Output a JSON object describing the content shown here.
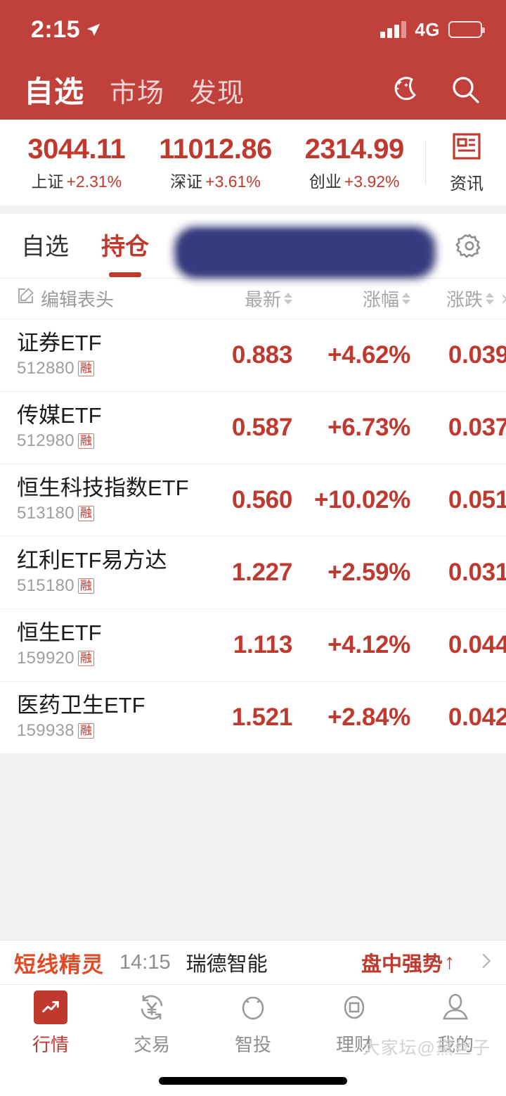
{
  "status_bar": {
    "time": "2:15",
    "location_icon": "location-arrow-icon",
    "signal_icon": "signal-bars-icon",
    "network": "4G",
    "battery_icon": "battery-low-icon",
    "battery_level_pct": 12
  },
  "header": {
    "tabs": [
      {
        "label": "自选",
        "active": true
      },
      {
        "label": "市场",
        "active": false
      },
      {
        "label": "发现",
        "active": false
      }
    ],
    "night_mode_icon": "moon-stars-icon",
    "search_icon": "search-icon",
    "background_color": "#c0413b"
  },
  "index_bar": {
    "indices": [
      {
        "value": "3044.11",
        "name": "上证",
        "change_pct": "+2.31%"
      },
      {
        "value": "11012.86",
        "name": "深证",
        "change_pct": "+3.61%"
      },
      {
        "value": "2314.99",
        "name": "创业",
        "change_pct": "+3.92%"
      }
    ],
    "news": {
      "label": "资讯",
      "icon": "news-document-icon"
    },
    "up_color": "#c0392f"
  },
  "sub_tabs": {
    "items": [
      {
        "label": "自选",
        "active": false
      },
      {
        "label": "持仓",
        "active": true
      },
      {
        "label": "",
        "active": false,
        "redacted": true
      }
    ],
    "settings_icon": "gear-icon",
    "redaction_color": "#2f3475"
  },
  "table": {
    "edit_header": {
      "label": "编辑表头",
      "icon": "edit-pencil-icon"
    },
    "columns": [
      {
        "label": "最新",
        "sortable": true
      },
      {
        "label": "涨幅",
        "sortable": true
      },
      {
        "label": "涨跌",
        "sortable": true
      }
    ],
    "more_icon": "chevron-right-icon",
    "rows": [
      {
        "name": "证券ETF",
        "code": "512880",
        "badge": "融",
        "last": "0.883",
        "change_pct": "+4.62%",
        "change": "0.039"
      },
      {
        "name": "传媒ETF",
        "code": "512980",
        "badge": "融",
        "last": "0.587",
        "change_pct": "+6.73%",
        "change": "0.037"
      },
      {
        "name": "恒生科技指数ETF",
        "code": "513180",
        "badge": "融",
        "last": "0.560",
        "change_pct": "+10.02%",
        "change": "0.051"
      },
      {
        "name": "红利ETF易方达",
        "code": "515180",
        "badge": "融",
        "last": "1.227",
        "change_pct": "+2.59%",
        "change": "0.031"
      },
      {
        "name": "恒生ETF",
        "code": "159920",
        "badge": "融",
        "last": "1.113",
        "change_pct": "+4.12%",
        "change": "0.044"
      },
      {
        "name": "医药卫生ETF",
        "code": "159938",
        "badge": "融",
        "last": "1.521",
        "change_pct": "+2.84%",
        "change": "0.042"
      }
    ]
  },
  "ticker": {
    "brand": "短线精灵",
    "time": "14:15",
    "stock_name": "瑞德智能",
    "tag": "盘中强势",
    "tag_arrow": "↑",
    "chevron_icon": "chevron-right-icon"
  },
  "bottom_nav": {
    "items": [
      {
        "label": "行情",
        "icon": "trend-chart-icon",
        "active": true
      },
      {
        "label": "交易",
        "icon": "yuan-exchange-icon",
        "active": false
      },
      {
        "label": "智投",
        "icon": "circle-brain-icon",
        "active": false
      },
      {
        "label": "理财",
        "icon": "wallet-circle-icon",
        "active": false
      },
      {
        "label": "我的",
        "icon": "user-person-icon",
        "active": false
      }
    ],
    "active_color": "#c0392f"
  },
  "watermark": {
    "text": "大家坛@黛丝子"
  }
}
